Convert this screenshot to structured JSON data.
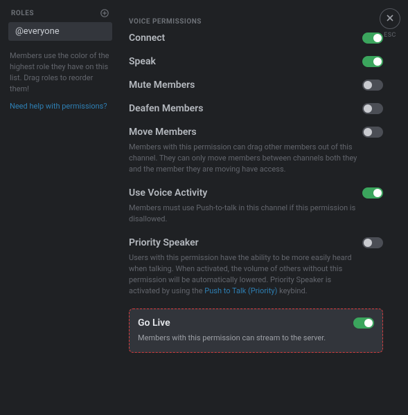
{
  "sidebar": {
    "header_label": "ROLES",
    "role_name": "@everyone",
    "help_text": "Members use the color of the highest role they have on this list. Drag roles to reorder them!",
    "help_link": "Need help with permissions?"
  },
  "close": {
    "esc_label": "ESC"
  },
  "section": {
    "title": "VOICE PERMISSIONS"
  },
  "permissions": {
    "connect": {
      "title": "Connect",
      "on": true
    },
    "speak": {
      "title": "Speak",
      "on": true
    },
    "mute_members": {
      "title": "Mute Members",
      "on": false
    },
    "deafen_members": {
      "title": "Deafen Members",
      "on": false
    },
    "move_members": {
      "title": "Move Members",
      "on": false,
      "desc": "Members with this permission can drag other members out of this channel. They can only move members between channels both they and the member they are moving have access."
    },
    "use_voice_activity": {
      "title": "Use Voice Activity",
      "on": true,
      "desc": "Members must use Push-to-talk in this channel if this permission is disallowed."
    },
    "priority_speaker": {
      "title": "Priority Speaker",
      "on": false,
      "desc_pre": "Users with this permission have the ability to be more easily heard when talking. When activated, the volume of others without this permission will be automatically lowered. Priority Speaker is activated by using the ",
      "desc_link": "Push to Talk (Priority)",
      "desc_post": " keybind."
    },
    "go_live": {
      "title": "Go Live",
      "on": true,
      "desc": "Members with this permission can stream to the server."
    }
  }
}
